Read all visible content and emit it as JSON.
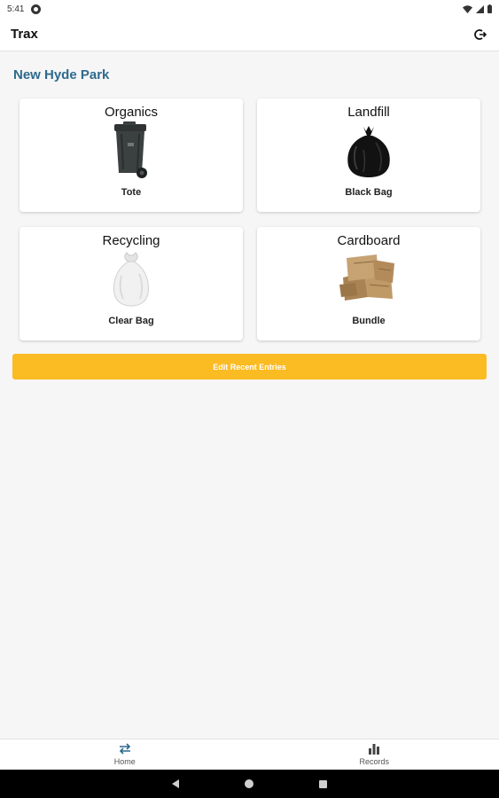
{
  "status_bar": {
    "time": "5:41"
  },
  "app_bar": {
    "title": "Trax"
  },
  "location": {
    "name": "New Hyde Park"
  },
  "cards": [
    {
      "title": "Organics",
      "subtitle": "Tote",
      "icon": "tote-bin-icon"
    },
    {
      "title": "Landfill",
      "subtitle": "Black Bag",
      "icon": "black-bag-icon"
    },
    {
      "title": "Recycling",
      "subtitle": "Clear Bag",
      "icon": "clear-bag-icon"
    },
    {
      "title": "Cardboard",
      "subtitle": "Bundle",
      "icon": "cardboard-bundle-icon"
    }
  ],
  "actions": {
    "edit_recent_label": "Edit Recent Entries"
  },
  "bottom_nav": {
    "items": [
      {
        "label": "Home",
        "icon": "swap-arrows-icon",
        "active": true
      },
      {
        "label": "Records",
        "icon": "bar-chart-icon",
        "active": false
      }
    ]
  },
  "colors": {
    "accent": "#fbbb23",
    "location_title": "#2d6a8e",
    "active_nav_icon": "#2d6a8e"
  }
}
